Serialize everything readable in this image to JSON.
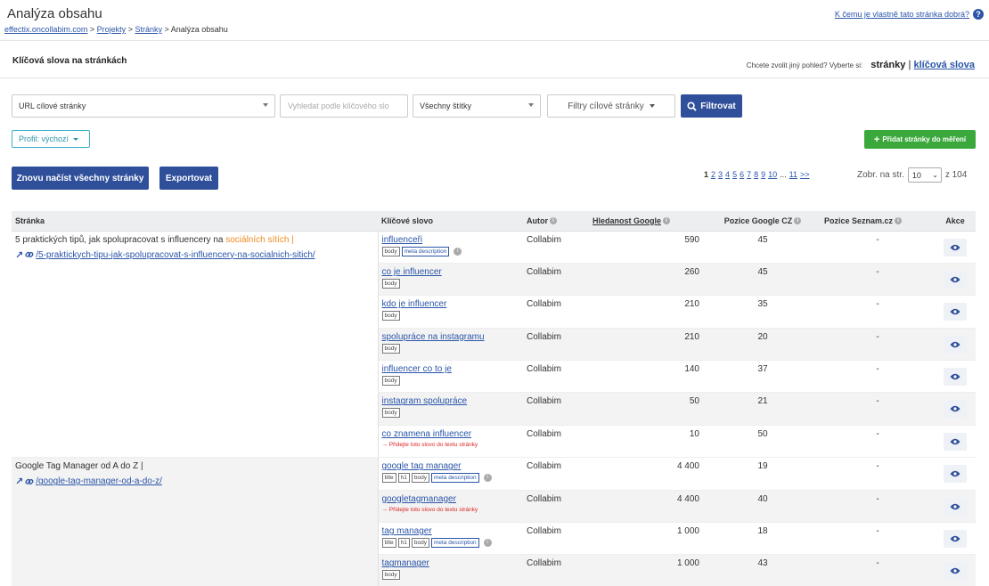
{
  "header": {
    "title": "Analýza obsahu",
    "breadcrumb": [
      "effectix.oncollabim.com",
      "Projekty",
      "Stránky"
    ],
    "breadcrumb_current": "Analýza obsahu",
    "help_link": "K čemu je vlastně tato stránka dobrá?"
  },
  "section": {
    "title": "Klíčová slova na stránkách",
    "view_prompt": "Chcete zvolit jiný pohled? Vyberte si:",
    "view_current": "stránky",
    "view_sep": "|",
    "view_alt": "klíčová slova"
  },
  "filters": {
    "url_select": "URL cílové stránky",
    "keyword_placeholder": "Vyhledat podle klíčového slo",
    "labels_select": "Všechny štítky",
    "page_filters": "Filtry cílové stránky",
    "filter_button": "Filtrovat",
    "profile": "Profil: výchozí",
    "add_button": "Přidat stránky do měření"
  },
  "actions": {
    "reload": "Znovu načíst všechny stránky",
    "export": "Exportovat"
  },
  "pagination": {
    "current": "1",
    "pages": [
      "2",
      "3",
      "4",
      "5",
      "6",
      "7",
      "8",
      "9",
      "10"
    ],
    "ellipsis": "...",
    "last": "11",
    "next": ">>",
    "per_page_label": "Zobr. na str.",
    "per_page_value": "10",
    "total": "z 104"
  },
  "table": {
    "columns": [
      "Stránka",
      "Klíčové slovo",
      "Autor",
      "Hledanost Google",
      "Pozice Google CZ",
      "Pozice Seznam.cz",
      "Akce"
    ],
    "pages": [
      {
        "title": "5 praktických tipů, jak spolupracovat s influencery na",
        "title_highlight": "sociálních sítích",
        "title_suffix": "|",
        "url": "/5-praktickych-tipu-jak-spolupracovat-s-influencery-na-socialnich-sitich/",
        "keywords": [
          {
            "kw": "influenceři",
            "tags": [
              "body",
              "meta description"
            ],
            "info": true,
            "author": "Collabim",
            "search": "590",
            "google": "45",
            "seznam": "-"
          },
          {
            "kw": "co je influencer",
            "tags": [
              "body"
            ],
            "author": "Collabim",
            "search": "260",
            "google": "45",
            "seznam": "-"
          },
          {
            "kw": "kdo je influencer",
            "tags": [
              "body"
            ],
            "author": "Collabim",
            "search": "210",
            "google": "35",
            "seznam": "-"
          },
          {
            "kw": "spolupráce na instagramu",
            "tags": [
              "body"
            ],
            "author": "Collabim",
            "search": "210",
            "google": "20",
            "seznam": "-"
          },
          {
            "kw": "influencer co to je",
            "tags": [
              "body"
            ],
            "author": "Collabim",
            "search": "140",
            "google": "37",
            "seznam": "-"
          },
          {
            "kw": "instagram spolupráce",
            "tags": [
              "body"
            ],
            "author": "Collabim",
            "search": "50",
            "google": "21",
            "seznam": "-"
          },
          {
            "kw": "co znamena influencer",
            "warning": "→ Přidejte toto slovo do textu stránky",
            "author": "Collabim",
            "search": "10",
            "google": "50",
            "seznam": "-"
          }
        ]
      },
      {
        "title": "Google Tag Manager od A do Z |",
        "title_highlight": "",
        "title_suffix": "",
        "url": "/google-tag-manager-od-a-do-z/",
        "keywords": [
          {
            "kw": "google tag manager",
            "tags": [
              "title",
              "h1",
              "body",
              "meta description"
            ],
            "info": true,
            "author": "Collabim",
            "search": "4 400",
            "google": "19",
            "seznam": "-"
          },
          {
            "kw": "googletagmanager",
            "warning": "→ Přidejte toto slovo do textu stránky",
            "author": "Collabim",
            "search": "4 400",
            "google": "40",
            "seznam": "-"
          },
          {
            "kw": "tag manager",
            "tags": [
              "title",
              "h1",
              "body",
              "meta description"
            ],
            "info": true,
            "author": "Collabim",
            "search": "1 000",
            "google": "18",
            "seznam": "-"
          },
          {
            "kw": "tagmanager",
            "tags": [
              "body"
            ],
            "author": "Collabim",
            "search": "1 000",
            "google": "43",
            "seznam": "-"
          }
        ]
      }
    ]
  },
  "colors": {
    "primary": "#2f4f9a",
    "success": "#3aa83a",
    "link": "#2a55a8",
    "highlight": "#f08a20",
    "warning": "#dd2222"
  },
  "icons": {
    "help": "question-circle-icon",
    "search": "search-icon",
    "plus": "plus-icon",
    "external": "external-link-icon",
    "chain": "link-icon",
    "view": "eye-icon",
    "info": "info-icon"
  }
}
